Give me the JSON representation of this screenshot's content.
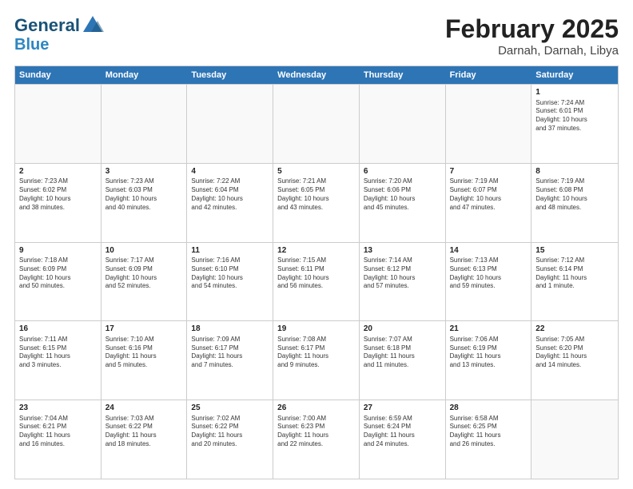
{
  "header": {
    "logo_general": "General",
    "logo_blue": "Blue",
    "title": "February 2025",
    "subtitle": "Darnah, Darnah, Libya"
  },
  "weekdays": [
    "Sunday",
    "Monday",
    "Tuesday",
    "Wednesday",
    "Thursday",
    "Friday",
    "Saturday"
  ],
  "weeks": [
    [
      {
        "day": "",
        "info": "",
        "empty": true
      },
      {
        "day": "",
        "info": "",
        "empty": true
      },
      {
        "day": "",
        "info": "",
        "empty": true
      },
      {
        "day": "",
        "info": "",
        "empty": true
      },
      {
        "day": "",
        "info": "",
        "empty": true
      },
      {
        "day": "",
        "info": "",
        "empty": true
      },
      {
        "day": "1",
        "info": "Sunrise: 7:24 AM\nSunset: 6:01 PM\nDaylight: 10 hours\nand 37 minutes."
      }
    ],
    [
      {
        "day": "2",
        "info": "Sunrise: 7:23 AM\nSunset: 6:02 PM\nDaylight: 10 hours\nand 38 minutes."
      },
      {
        "day": "3",
        "info": "Sunrise: 7:23 AM\nSunset: 6:03 PM\nDaylight: 10 hours\nand 40 minutes."
      },
      {
        "day": "4",
        "info": "Sunrise: 7:22 AM\nSunset: 6:04 PM\nDaylight: 10 hours\nand 42 minutes."
      },
      {
        "day": "5",
        "info": "Sunrise: 7:21 AM\nSunset: 6:05 PM\nDaylight: 10 hours\nand 43 minutes."
      },
      {
        "day": "6",
        "info": "Sunrise: 7:20 AM\nSunset: 6:06 PM\nDaylight: 10 hours\nand 45 minutes."
      },
      {
        "day": "7",
        "info": "Sunrise: 7:19 AM\nSunset: 6:07 PM\nDaylight: 10 hours\nand 47 minutes."
      },
      {
        "day": "8",
        "info": "Sunrise: 7:19 AM\nSunset: 6:08 PM\nDaylight: 10 hours\nand 48 minutes."
      }
    ],
    [
      {
        "day": "9",
        "info": "Sunrise: 7:18 AM\nSunset: 6:09 PM\nDaylight: 10 hours\nand 50 minutes."
      },
      {
        "day": "10",
        "info": "Sunrise: 7:17 AM\nSunset: 6:09 PM\nDaylight: 10 hours\nand 52 minutes."
      },
      {
        "day": "11",
        "info": "Sunrise: 7:16 AM\nSunset: 6:10 PM\nDaylight: 10 hours\nand 54 minutes."
      },
      {
        "day": "12",
        "info": "Sunrise: 7:15 AM\nSunset: 6:11 PM\nDaylight: 10 hours\nand 56 minutes."
      },
      {
        "day": "13",
        "info": "Sunrise: 7:14 AM\nSunset: 6:12 PM\nDaylight: 10 hours\nand 57 minutes."
      },
      {
        "day": "14",
        "info": "Sunrise: 7:13 AM\nSunset: 6:13 PM\nDaylight: 10 hours\nand 59 minutes."
      },
      {
        "day": "15",
        "info": "Sunrise: 7:12 AM\nSunset: 6:14 PM\nDaylight: 11 hours\nand 1 minute."
      }
    ],
    [
      {
        "day": "16",
        "info": "Sunrise: 7:11 AM\nSunset: 6:15 PM\nDaylight: 11 hours\nand 3 minutes."
      },
      {
        "day": "17",
        "info": "Sunrise: 7:10 AM\nSunset: 6:16 PM\nDaylight: 11 hours\nand 5 minutes."
      },
      {
        "day": "18",
        "info": "Sunrise: 7:09 AM\nSunset: 6:17 PM\nDaylight: 11 hours\nand 7 minutes."
      },
      {
        "day": "19",
        "info": "Sunrise: 7:08 AM\nSunset: 6:17 PM\nDaylight: 11 hours\nand 9 minutes."
      },
      {
        "day": "20",
        "info": "Sunrise: 7:07 AM\nSunset: 6:18 PM\nDaylight: 11 hours\nand 11 minutes."
      },
      {
        "day": "21",
        "info": "Sunrise: 7:06 AM\nSunset: 6:19 PM\nDaylight: 11 hours\nand 13 minutes."
      },
      {
        "day": "22",
        "info": "Sunrise: 7:05 AM\nSunset: 6:20 PM\nDaylight: 11 hours\nand 14 minutes."
      }
    ],
    [
      {
        "day": "23",
        "info": "Sunrise: 7:04 AM\nSunset: 6:21 PM\nDaylight: 11 hours\nand 16 minutes."
      },
      {
        "day": "24",
        "info": "Sunrise: 7:03 AM\nSunset: 6:22 PM\nDaylight: 11 hours\nand 18 minutes."
      },
      {
        "day": "25",
        "info": "Sunrise: 7:02 AM\nSunset: 6:22 PM\nDaylight: 11 hours\nand 20 minutes."
      },
      {
        "day": "26",
        "info": "Sunrise: 7:00 AM\nSunset: 6:23 PM\nDaylight: 11 hours\nand 22 minutes."
      },
      {
        "day": "27",
        "info": "Sunrise: 6:59 AM\nSunset: 6:24 PM\nDaylight: 11 hours\nand 24 minutes."
      },
      {
        "day": "28",
        "info": "Sunrise: 6:58 AM\nSunset: 6:25 PM\nDaylight: 11 hours\nand 26 minutes."
      },
      {
        "day": "",
        "info": "",
        "empty": true
      }
    ]
  ],
  "accent_color": "#2e75b6"
}
